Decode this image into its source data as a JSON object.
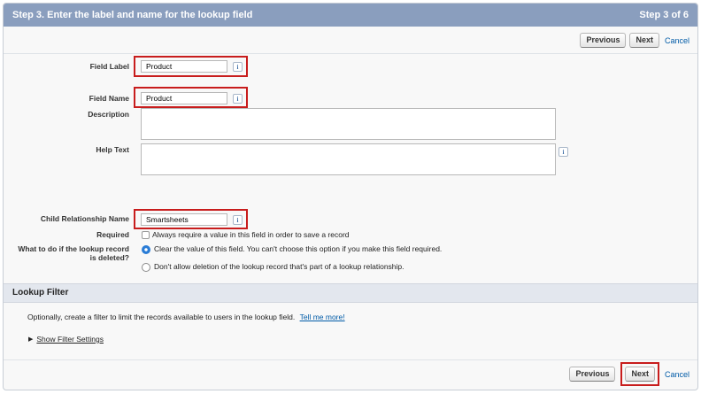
{
  "header": {
    "title": "Step 3. Enter the label and name for the lookup field",
    "step": "Step 3 of 6"
  },
  "buttons": {
    "previous": "Previous",
    "next": "Next",
    "cancel": "Cancel"
  },
  "fields": {
    "field_label": {
      "label": "Field Label",
      "value": "Product"
    },
    "field_name": {
      "label": "Field Name",
      "value": "Product"
    },
    "description": {
      "label": "Description",
      "value": ""
    },
    "help_text": {
      "label": "Help Text",
      "value": ""
    },
    "child_relationship": {
      "label": "Child Relationship Name",
      "value": "Smartsheets"
    },
    "required": {
      "label": "Required",
      "option": "Always require a value in this field in order to save a record",
      "checked": false
    },
    "deletion": {
      "label_line1": "What to do if the lookup record",
      "label_line2": "is deleted?",
      "options": [
        "Clear the value of this field. You can't choose this option if you make this field required.",
        "Don't allow deletion of the lookup record that's part of a lookup relationship."
      ],
      "selected_index": 0
    }
  },
  "info_icon_glyph": "i",
  "lookup_filter": {
    "title": "Lookup Filter",
    "description": "Optionally, create a filter to limit the records available to users in the lookup field.",
    "link": "Tell me more!",
    "toggle": "Show Filter Settings"
  },
  "colors": {
    "header_bg": "#8a9ebe",
    "highlight": "#c81d1d",
    "link": "#015ba7"
  }
}
